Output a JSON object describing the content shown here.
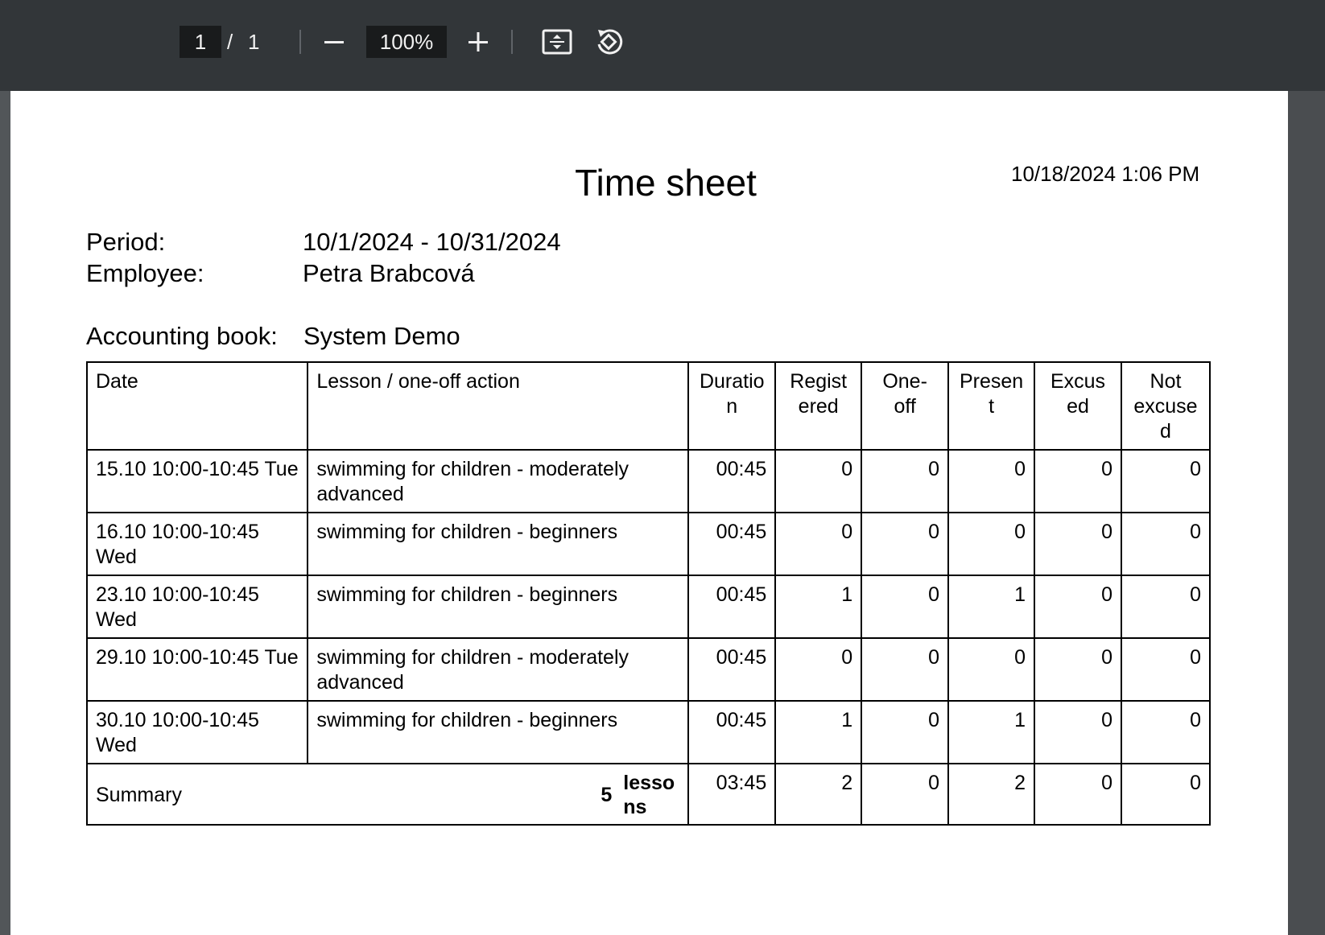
{
  "toolbar": {
    "current_page": "1",
    "page_separator": "/",
    "total_pages": "1",
    "zoom": "100%"
  },
  "document": {
    "title": "Time sheet",
    "timestamp": "10/18/2024 1:06 PM",
    "period_label": "Period:",
    "period_value": "10/1/2024 - 10/31/2024",
    "employee_label": "Employee:",
    "employee_value": "Petra Brabcová",
    "book_label": "Accounting book:",
    "book_value": "System Demo"
  },
  "table": {
    "headers": [
      "Date",
      "Lesson / one-off action",
      "Duratio n",
      "Regist ered",
      "One- off",
      "Presen t",
      "Excus ed",
      "Not excuse d"
    ],
    "rows": [
      {
        "date": "15.10 10:00-10:45 Tue",
        "lesson": "swimming for children - moderately advanced",
        "duration": "00:45",
        "registered": "0",
        "oneoff": "0",
        "present": "0",
        "excused": "0",
        "not_excused": "0"
      },
      {
        "date": "16.10 10:00-10:45 Wed",
        "lesson": "swimming for children - beginners",
        "duration": "00:45",
        "registered": "0",
        "oneoff": "0",
        "present": "0",
        "excused": "0",
        "not_excused": "0"
      },
      {
        "date": "23.10 10:00-10:45 Wed",
        "lesson": "swimming for children - beginners",
        "duration": "00:45",
        "registered": "1",
        "oneoff": "0",
        "present": "1",
        "excused": "0",
        "not_excused": "0"
      },
      {
        "date": "29.10 10:00-10:45 Tue",
        "lesson": "swimming for children - moderately advanced",
        "duration": "00:45",
        "registered": "0",
        "oneoff": "0",
        "present": "0",
        "excused": "0",
        "not_excused": "0"
      },
      {
        "date": "30.10 10:00-10:45 Wed",
        "lesson": "swimming for children - beginners",
        "duration": "00:45",
        "registered": "1",
        "oneoff": "0",
        "present": "1",
        "excused": "0",
        "not_excused": "0"
      }
    ],
    "summary": {
      "label": "Summary",
      "count": "5",
      "count_unit": "lesso ns",
      "duration": "03:45",
      "registered": "2",
      "oneoff": "0",
      "present": "2",
      "excused": "0",
      "not_excused": "0"
    }
  },
  "icons": {
    "zoom_out": "minus-icon",
    "zoom_in": "plus-icon",
    "fit_page": "fit-to-page-icon",
    "rotate": "rotate-icon"
  }
}
